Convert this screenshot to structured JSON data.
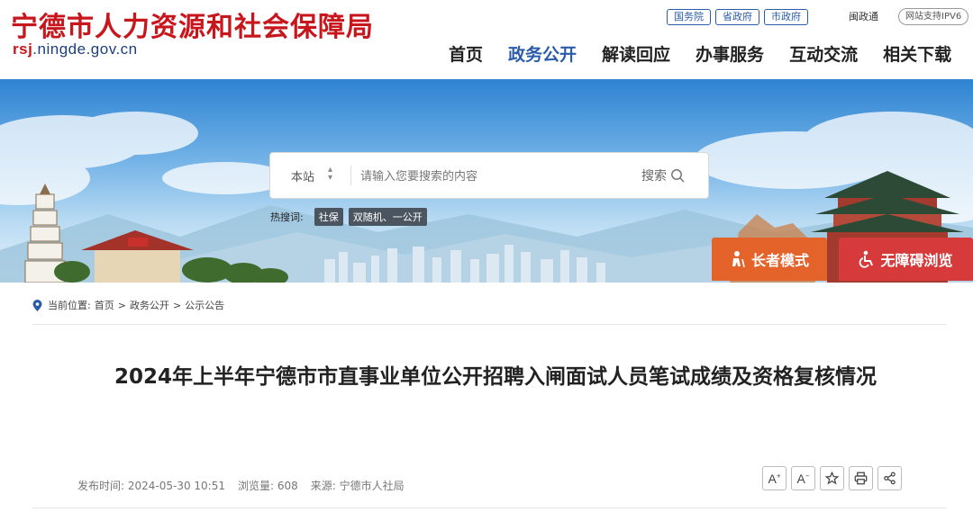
{
  "header": {
    "site_title": "宁德市人力资源和社会保障局",
    "site_url_bold": "rsj",
    "site_url_rest": ".ningde.gov.cn",
    "gov_links": [
      "国务院",
      "省政府",
      "市政府"
    ],
    "mdzw": "闽政通",
    "ipv6_badge": "网站支持IPV6",
    "nav": [
      "首页",
      "政务公开",
      "解读回应",
      "办事服务",
      "互动交流",
      "相关下载"
    ],
    "active_nav": "政务公开"
  },
  "search": {
    "scope": "本站",
    "placeholder": "请输入您要搜索的内容",
    "button_label": "搜索"
  },
  "hot_search": {
    "label": "热搜词:",
    "tags": [
      "社保",
      "双随机、一公开"
    ]
  },
  "modes": {
    "elder_label": "长者模式",
    "access_label": "无障碍浏览"
  },
  "breadcrumb": {
    "prefix": "当前位置:",
    "items": [
      "首页",
      "政务公开",
      "公示公告"
    ],
    "separator": ">"
  },
  "article": {
    "title": "2024年上半年宁德市市直事业单位公开招聘入闸面试人员笔试成绩及资格复核情况",
    "publish_time": "发布时间: 2024-05-30 10:51",
    "views": "浏览量: 608",
    "source": "来源: 宁德市人社局"
  },
  "colors": {
    "brand_red": "#c8161d",
    "brand_blue": "#2a5caa",
    "elder_orange": "#e3632b",
    "access_red": "#d63a3a"
  }
}
